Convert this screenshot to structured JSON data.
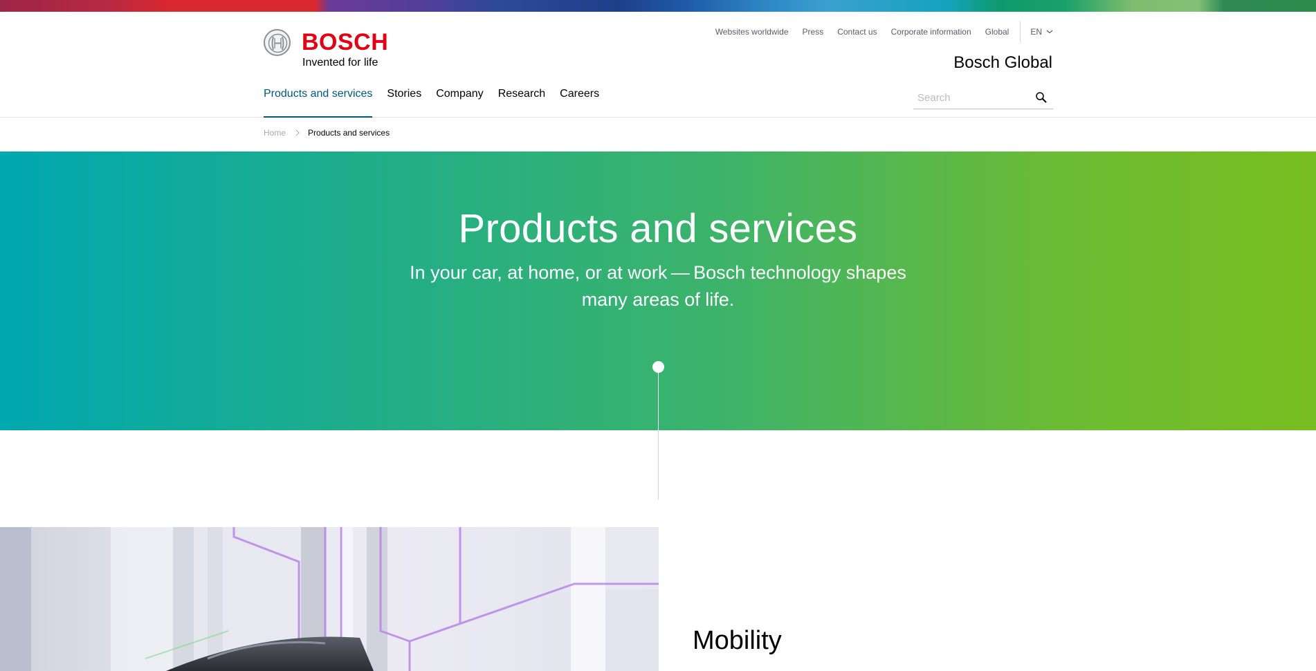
{
  "brand": {
    "name": "BOSCH",
    "tagline": "Invented for life",
    "logo_icon": "bosch-armature-icon",
    "brand_red": "#e20015"
  },
  "utility_nav": {
    "items": [
      "Websites worldwide",
      "Press",
      "Contact us",
      "Corporate information",
      "Global"
    ],
    "language": "EN",
    "language_icon": "chevron-down-icon"
  },
  "site_title": "Bosch Global",
  "main_nav": {
    "items": [
      "Products and services",
      "Stories",
      "Company",
      "Research",
      "Careers"
    ],
    "active": "Products and services",
    "accent_color": "#00567c"
  },
  "search": {
    "placeholder": "Search",
    "value": "",
    "icon": "search-icon"
  },
  "breadcrumb": {
    "home": "Home",
    "separator_icon": "chevron-right-icon",
    "current": "Products and services"
  },
  "hero": {
    "title": "Products and services",
    "subtitle": "In your car, at home, or at work — Bosch technology shapes many areas of life.",
    "gradient_start": "#00a8b0",
    "gradient_end": "#78be20"
  },
  "section": {
    "title": "Mobility"
  }
}
